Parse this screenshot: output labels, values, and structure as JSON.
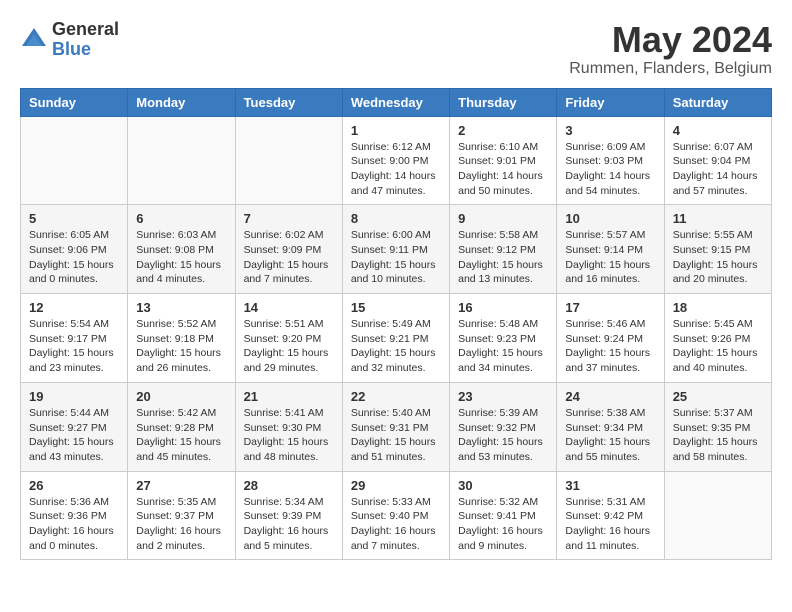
{
  "logo": {
    "general": "General",
    "blue": "Blue"
  },
  "title": {
    "month_year": "May 2024",
    "location": "Rummen, Flanders, Belgium"
  },
  "headers": [
    "Sunday",
    "Monday",
    "Tuesday",
    "Wednesday",
    "Thursday",
    "Friday",
    "Saturday"
  ],
  "weeks": [
    [
      {
        "day": "",
        "sunrise": "",
        "sunset": "",
        "daylight": ""
      },
      {
        "day": "",
        "sunrise": "",
        "sunset": "",
        "daylight": ""
      },
      {
        "day": "",
        "sunrise": "",
        "sunset": "",
        "daylight": ""
      },
      {
        "day": "1",
        "sunrise": "Sunrise: 6:12 AM",
        "sunset": "Sunset: 9:00 PM",
        "daylight": "Daylight: 14 hours and 47 minutes."
      },
      {
        "day": "2",
        "sunrise": "Sunrise: 6:10 AM",
        "sunset": "Sunset: 9:01 PM",
        "daylight": "Daylight: 14 hours and 50 minutes."
      },
      {
        "day": "3",
        "sunrise": "Sunrise: 6:09 AM",
        "sunset": "Sunset: 9:03 PM",
        "daylight": "Daylight: 14 hours and 54 minutes."
      },
      {
        "day": "4",
        "sunrise": "Sunrise: 6:07 AM",
        "sunset": "Sunset: 9:04 PM",
        "daylight": "Daylight: 14 hours and 57 minutes."
      }
    ],
    [
      {
        "day": "5",
        "sunrise": "Sunrise: 6:05 AM",
        "sunset": "Sunset: 9:06 PM",
        "daylight": "Daylight: 15 hours and 0 minutes."
      },
      {
        "day": "6",
        "sunrise": "Sunrise: 6:03 AM",
        "sunset": "Sunset: 9:08 PM",
        "daylight": "Daylight: 15 hours and 4 minutes."
      },
      {
        "day": "7",
        "sunrise": "Sunrise: 6:02 AM",
        "sunset": "Sunset: 9:09 PM",
        "daylight": "Daylight: 15 hours and 7 minutes."
      },
      {
        "day": "8",
        "sunrise": "Sunrise: 6:00 AM",
        "sunset": "Sunset: 9:11 PM",
        "daylight": "Daylight: 15 hours and 10 minutes."
      },
      {
        "day": "9",
        "sunrise": "Sunrise: 5:58 AM",
        "sunset": "Sunset: 9:12 PM",
        "daylight": "Daylight: 15 hours and 13 minutes."
      },
      {
        "day": "10",
        "sunrise": "Sunrise: 5:57 AM",
        "sunset": "Sunset: 9:14 PM",
        "daylight": "Daylight: 15 hours and 16 minutes."
      },
      {
        "day": "11",
        "sunrise": "Sunrise: 5:55 AM",
        "sunset": "Sunset: 9:15 PM",
        "daylight": "Daylight: 15 hours and 20 minutes."
      }
    ],
    [
      {
        "day": "12",
        "sunrise": "Sunrise: 5:54 AM",
        "sunset": "Sunset: 9:17 PM",
        "daylight": "Daylight: 15 hours and 23 minutes."
      },
      {
        "day": "13",
        "sunrise": "Sunrise: 5:52 AM",
        "sunset": "Sunset: 9:18 PM",
        "daylight": "Daylight: 15 hours and 26 minutes."
      },
      {
        "day": "14",
        "sunrise": "Sunrise: 5:51 AM",
        "sunset": "Sunset: 9:20 PM",
        "daylight": "Daylight: 15 hours and 29 minutes."
      },
      {
        "day": "15",
        "sunrise": "Sunrise: 5:49 AM",
        "sunset": "Sunset: 9:21 PM",
        "daylight": "Daylight: 15 hours and 32 minutes."
      },
      {
        "day": "16",
        "sunrise": "Sunrise: 5:48 AM",
        "sunset": "Sunset: 9:23 PM",
        "daylight": "Daylight: 15 hours and 34 minutes."
      },
      {
        "day": "17",
        "sunrise": "Sunrise: 5:46 AM",
        "sunset": "Sunset: 9:24 PM",
        "daylight": "Daylight: 15 hours and 37 minutes."
      },
      {
        "day": "18",
        "sunrise": "Sunrise: 5:45 AM",
        "sunset": "Sunset: 9:26 PM",
        "daylight": "Daylight: 15 hours and 40 minutes."
      }
    ],
    [
      {
        "day": "19",
        "sunrise": "Sunrise: 5:44 AM",
        "sunset": "Sunset: 9:27 PM",
        "daylight": "Daylight: 15 hours and 43 minutes."
      },
      {
        "day": "20",
        "sunrise": "Sunrise: 5:42 AM",
        "sunset": "Sunset: 9:28 PM",
        "daylight": "Daylight: 15 hours and 45 minutes."
      },
      {
        "day": "21",
        "sunrise": "Sunrise: 5:41 AM",
        "sunset": "Sunset: 9:30 PM",
        "daylight": "Daylight: 15 hours and 48 minutes."
      },
      {
        "day": "22",
        "sunrise": "Sunrise: 5:40 AM",
        "sunset": "Sunset: 9:31 PM",
        "daylight": "Daylight: 15 hours and 51 minutes."
      },
      {
        "day": "23",
        "sunrise": "Sunrise: 5:39 AM",
        "sunset": "Sunset: 9:32 PM",
        "daylight": "Daylight: 15 hours and 53 minutes."
      },
      {
        "day": "24",
        "sunrise": "Sunrise: 5:38 AM",
        "sunset": "Sunset: 9:34 PM",
        "daylight": "Daylight: 15 hours and 55 minutes."
      },
      {
        "day": "25",
        "sunrise": "Sunrise: 5:37 AM",
        "sunset": "Sunset: 9:35 PM",
        "daylight": "Daylight: 15 hours and 58 minutes."
      }
    ],
    [
      {
        "day": "26",
        "sunrise": "Sunrise: 5:36 AM",
        "sunset": "Sunset: 9:36 PM",
        "daylight": "Daylight: 16 hours and 0 minutes."
      },
      {
        "day": "27",
        "sunrise": "Sunrise: 5:35 AM",
        "sunset": "Sunset: 9:37 PM",
        "daylight": "Daylight: 16 hours and 2 minutes."
      },
      {
        "day": "28",
        "sunrise": "Sunrise: 5:34 AM",
        "sunset": "Sunset: 9:39 PM",
        "daylight": "Daylight: 16 hours and 5 minutes."
      },
      {
        "day": "29",
        "sunrise": "Sunrise: 5:33 AM",
        "sunset": "Sunset: 9:40 PM",
        "daylight": "Daylight: 16 hours and 7 minutes."
      },
      {
        "day": "30",
        "sunrise": "Sunrise: 5:32 AM",
        "sunset": "Sunset: 9:41 PM",
        "daylight": "Daylight: 16 hours and 9 minutes."
      },
      {
        "day": "31",
        "sunrise": "Sunrise: 5:31 AM",
        "sunset": "Sunset: 9:42 PM",
        "daylight": "Daylight: 16 hours and 11 minutes."
      },
      {
        "day": "",
        "sunrise": "",
        "sunset": "",
        "daylight": ""
      }
    ]
  ]
}
